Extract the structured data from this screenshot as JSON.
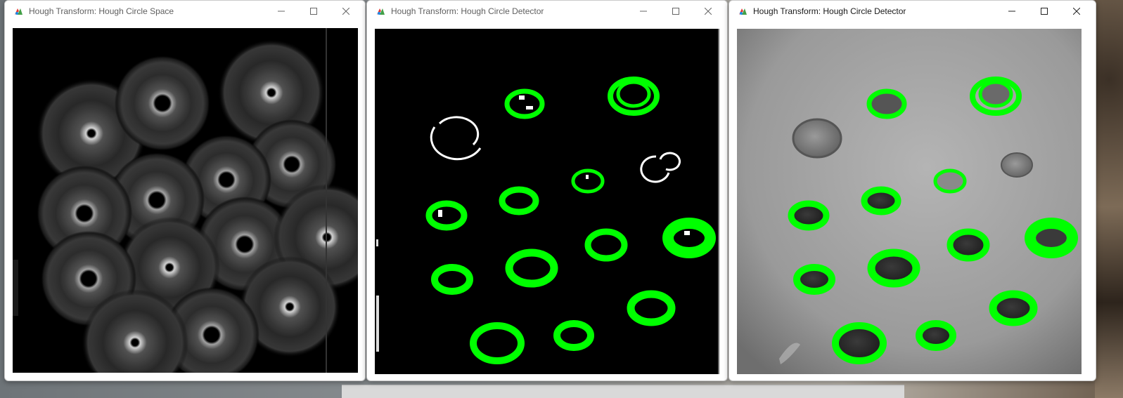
{
  "windows": [
    {
      "title": "Hough Transform: Hough Circle Space",
      "active": false
    },
    {
      "title": "Hough Transform: Hough Circle Detector",
      "active": false
    },
    {
      "title": "Hough Transform: Hough Circle Detector",
      "active": true
    }
  ],
  "controls": {
    "minimize_icon": "minimize-icon",
    "maximize_icon": "maximize-icon",
    "close_icon": "close-icon"
  },
  "colors": {
    "detection_green": "#00ff00",
    "edge_white": "#ffffff",
    "background_black": "#000000",
    "title_bar": "#ffffff"
  }
}
